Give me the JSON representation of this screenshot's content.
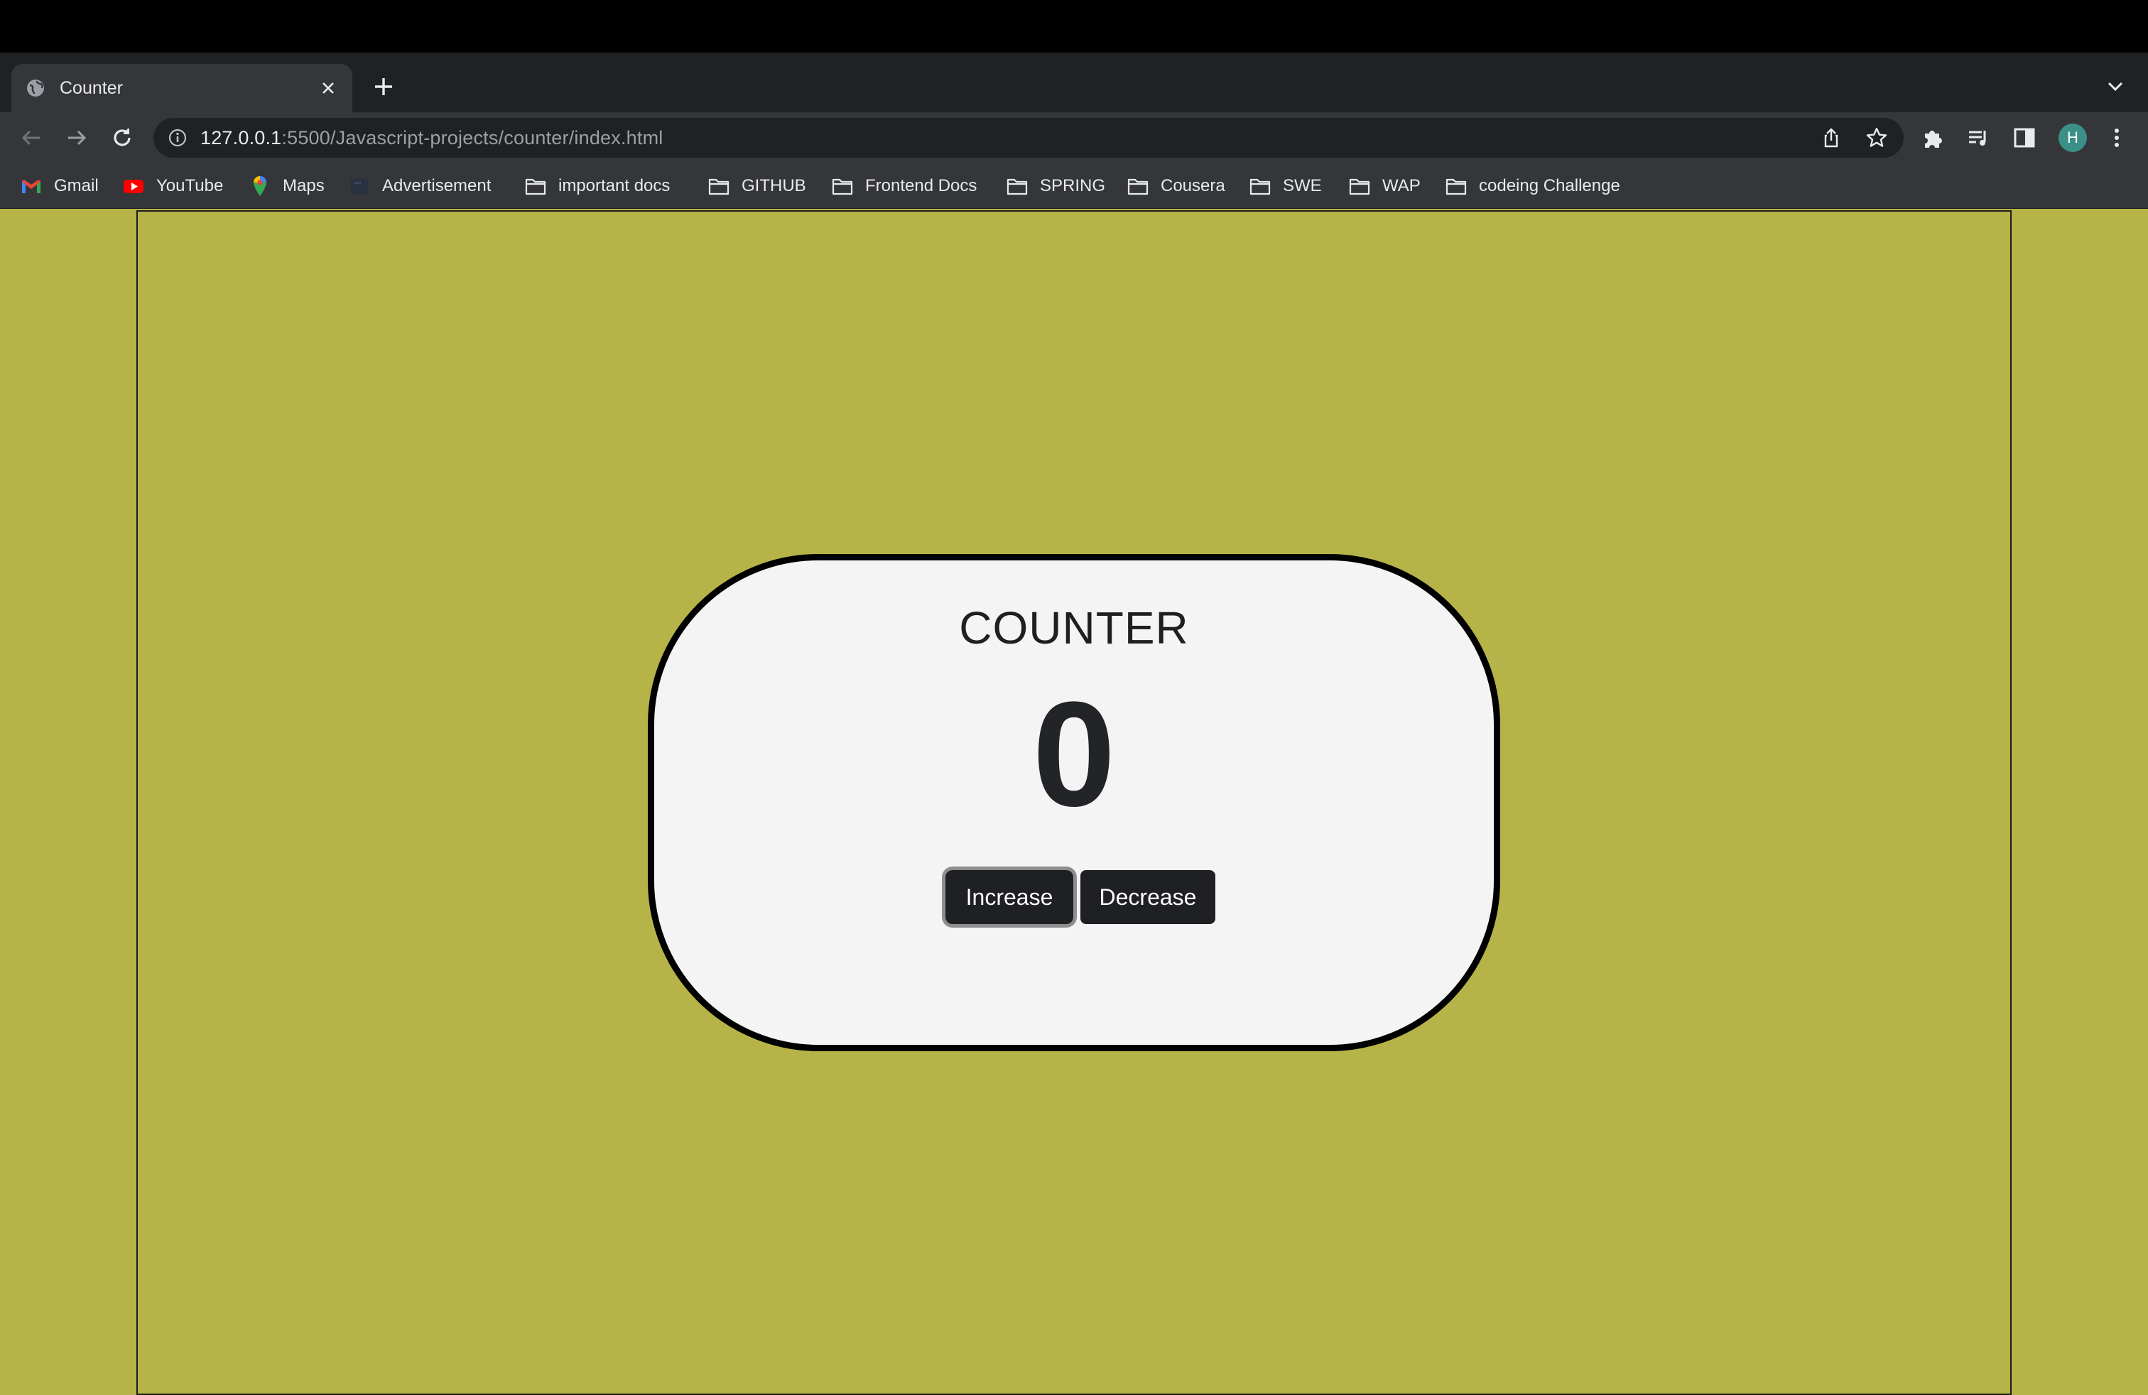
{
  "browser": {
    "tab": {
      "title": "Counter"
    },
    "url": {
      "host": "127.0.0.1",
      "rest": ":5500/Javascript-projects/counter/index.html"
    },
    "profile_initial": "H",
    "bookmarks": [
      {
        "label": "Gmail",
        "icon": "gmail-icon"
      },
      {
        "label": "YouTube",
        "icon": "youtube-icon"
      },
      {
        "label": "Maps",
        "icon": "maps-icon"
      },
      {
        "label": "Advertisement",
        "icon": "page-icon"
      },
      {
        "label": "important docs",
        "icon": "folder-icon"
      },
      {
        "label": "GITHUB",
        "icon": "folder-icon"
      },
      {
        "label": "Frontend Docs",
        "icon": "folder-icon"
      },
      {
        "label": "SPRING",
        "icon": "folder-icon"
      },
      {
        "label": "Cousera",
        "icon": "folder-icon"
      },
      {
        "label": "SWE",
        "icon": "folder-icon"
      },
      {
        "label": "WAP",
        "icon": "folder-icon"
      },
      {
        "label": "codeing Challenge",
        "icon": "folder-icon"
      }
    ]
  },
  "page": {
    "title": "COUNTER",
    "count": "0",
    "increase_label": "Increase",
    "decrease_label": "Decrease",
    "background_color": "#b6b448",
    "card_color": "#f4f4f4",
    "button_color": "#1f2023"
  }
}
